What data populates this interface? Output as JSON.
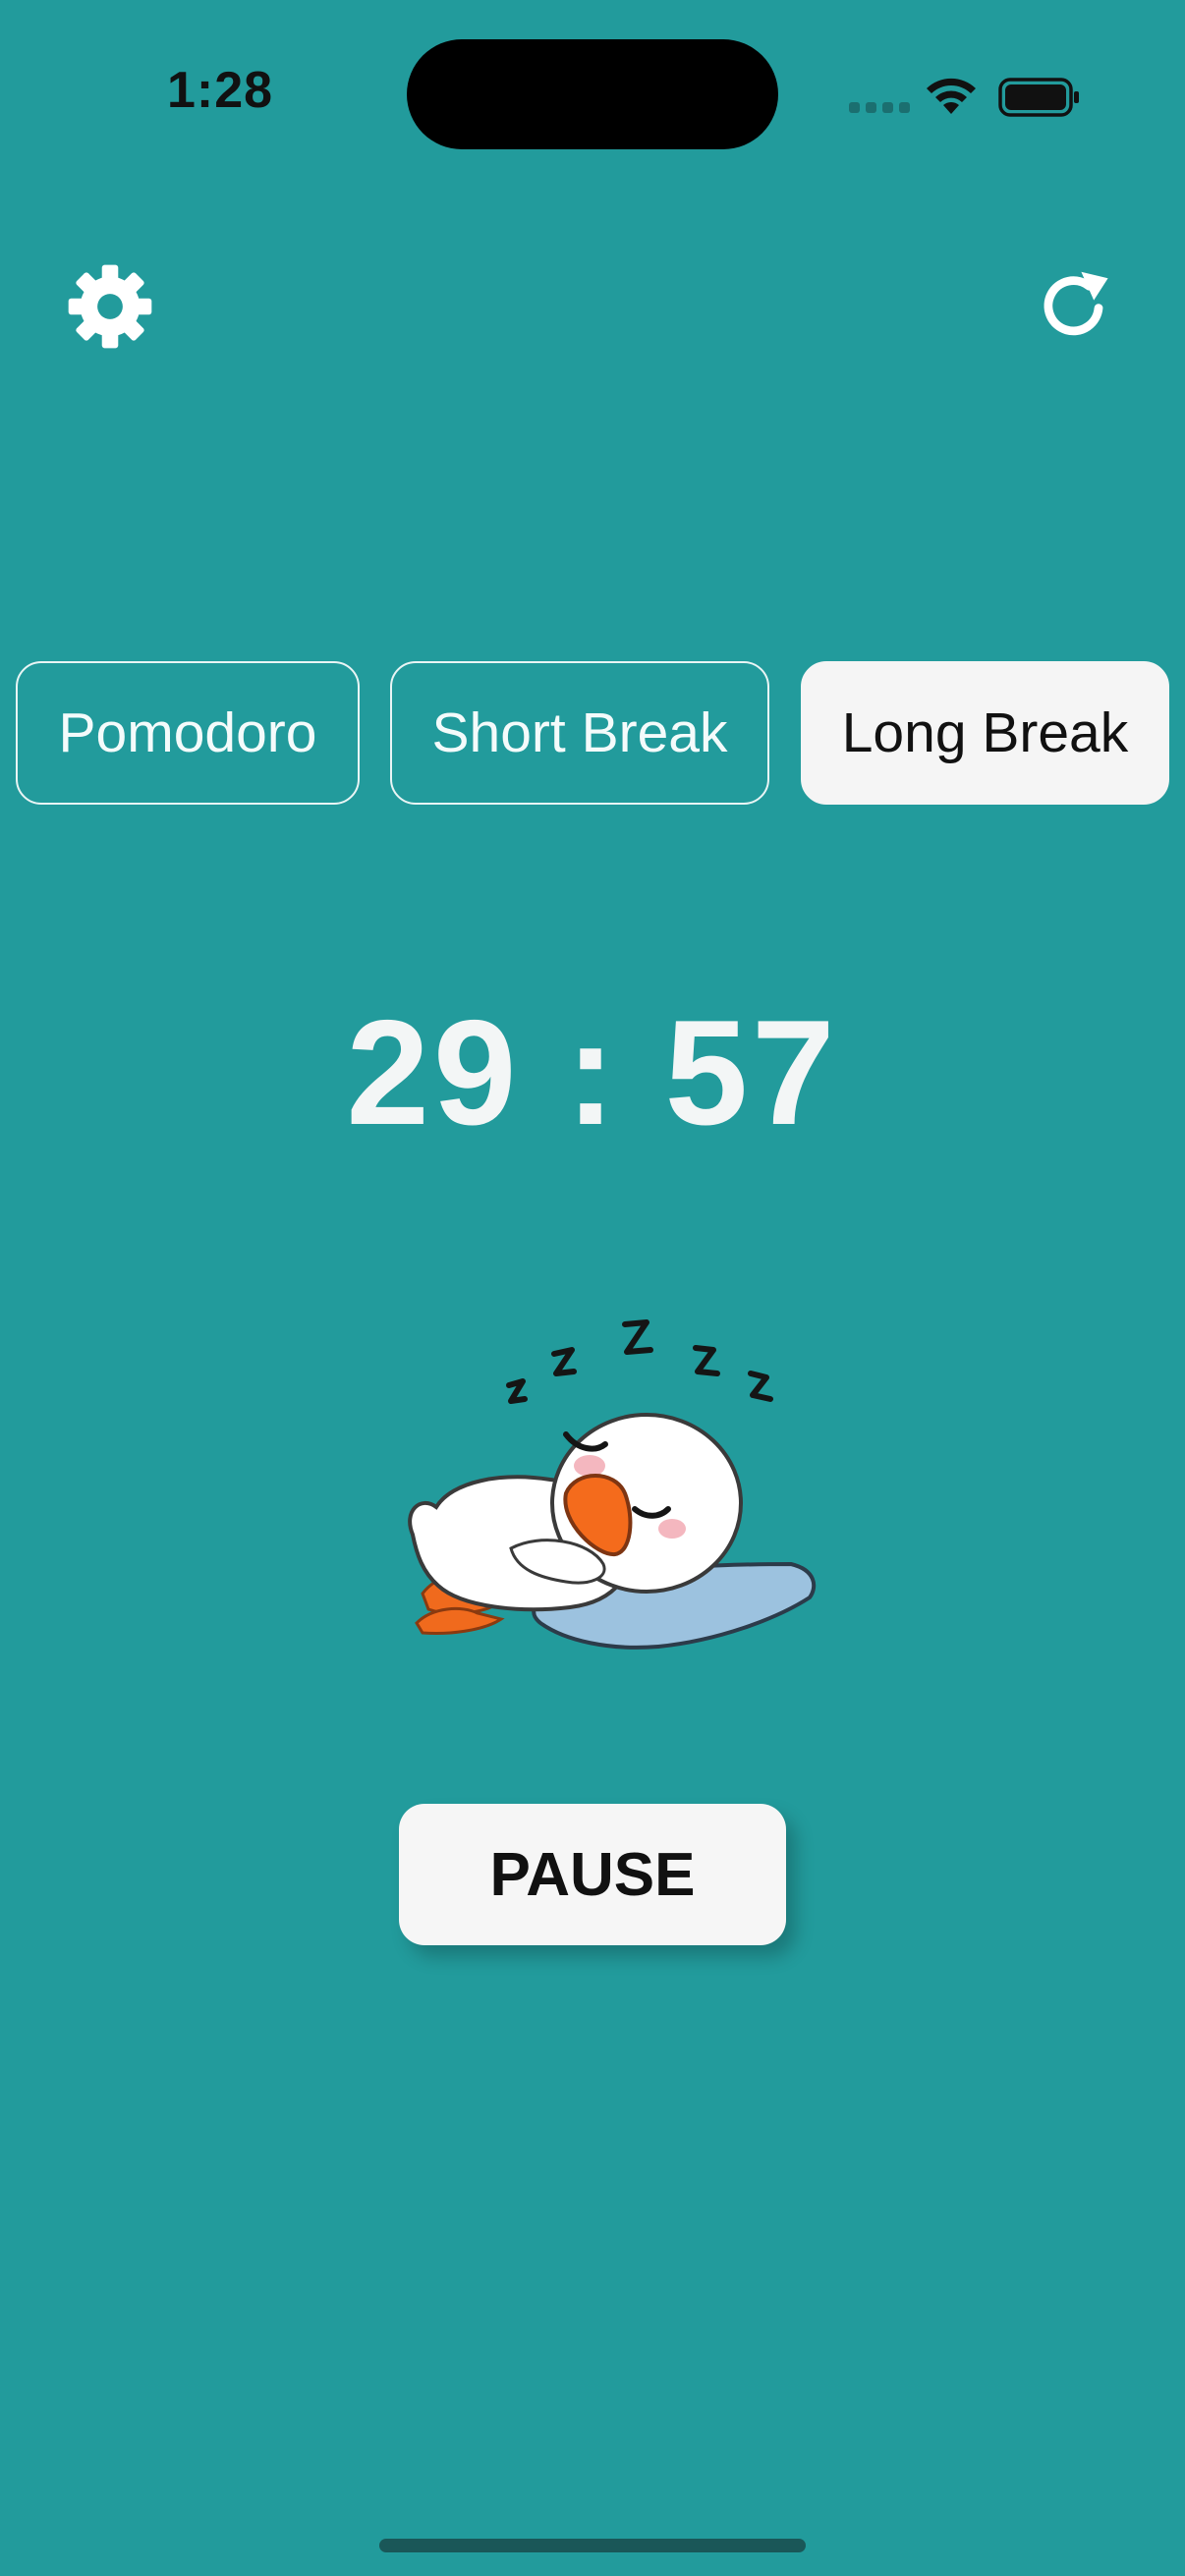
{
  "status_bar": {
    "time": "1:28"
  },
  "toolbar": {
    "settings_icon": "gear-icon",
    "reset_icon": "refresh-icon"
  },
  "tabs": [
    {
      "label": "Pomodoro",
      "active": false
    },
    {
      "label": "Short Break",
      "active": false
    },
    {
      "label": "Long Break",
      "active": true
    }
  ],
  "timer": {
    "display": "29 : 57"
  },
  "illustration": {
    "icon": "sleeping-duck-illustration"
  },
  "controls": {
    "pause_label": "PAUSE"
  },
  "colors": {
    "background": "#229b9c",
    "button_background": "#f6f6f6",
    "text_light": "#f3f6f6",
    "text_dark": "#111111"
  }
}
